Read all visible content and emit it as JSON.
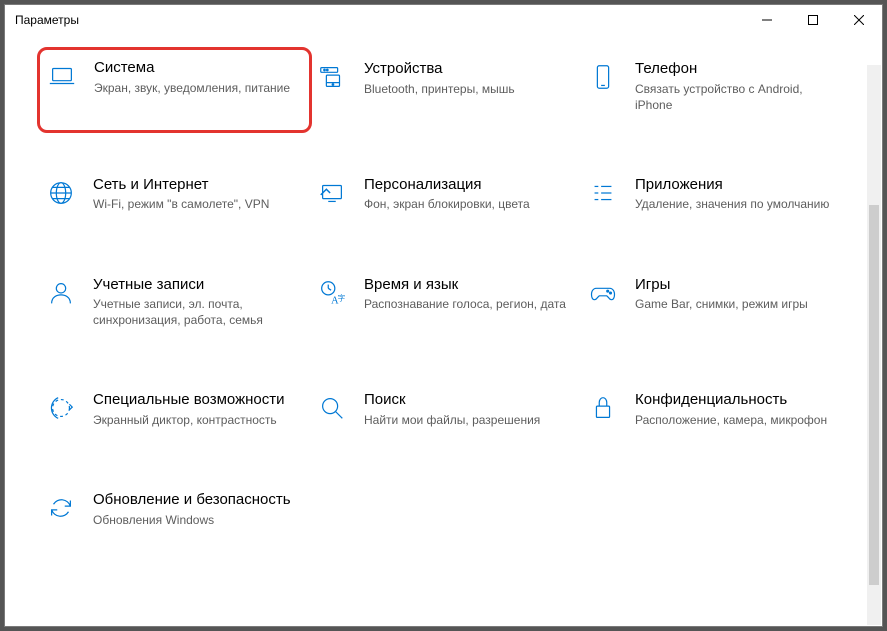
{
  "window": {
    "title": "Параметры"
  },
  "tiles": [
    {
      "title": "Система",
      "sub": "Экран, звук, уведомления, питание"
    },
    {
      "title": "Устройства",
      "sub": "Bluetooth, принтеры, мышь"
    },
    {
      "title": "Телефон",
      "sub": "Связать устройство с Android, iPhone"
    },
    {
      "title": "Сеть и Интернет",
      "sub": "Wi-Fi, режим \"в самолете\", VPN"
    },
    {
      "title": "Персонализация",
      "sub": "Фон, экран блокировки, цвета"
    },
    {
      "title": "Приложения",
      "sub": "Удаление, значения по умолчанию"
    },
    {
      "title": "Учетные записи",
      "sub": "Учетные записи, эл. почта, синхронизация, работа, семья"
    },
    {
      "title": "Время и язык",
      "sub": "Распознавание голоса, регион, дата"
    },
    {
      "title": "Игры",
      "sub": "Game Bar, снимки, режим игры"
    },
    {
      "title": "Специальные возможности",
      "sub": "Экранный диктор, контрастность"
    },
    {
      "title": "Поиск",
      "sub": "Найти мои файлы, разрешения"
    },
    {
      "title": "Конфиденциальность",
      "sub": "Расположение, камера, микрофон"
    },
    {
      "title": "Обновление и безопасность",
      "sub": "Обновления Windows"
    }
  ]
}
